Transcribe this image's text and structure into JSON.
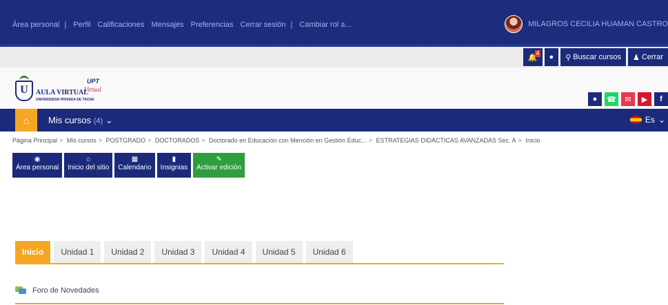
{
  "topnav": {
    "links": [
      "Área personal",
      "Perfil",
      "Calificaciones",
      "Mensajes",
      "Preferencias",
      "Cerrar sesión",
      "Cambiar rol a..."
    ],
    "user_name": "MILAGROS CECILIA HUAMAN CASTRO"
  },
  "toolbar": {
    "notifications_count": "4",
    "search_label": "Buscar cursos",
    "close_label": "Cerrar"
  },
  "logo": {
    "name": "AULA VIRTUAL",
    "sub": "UNIVERSIDAD PRIVADA DE TACNA",
    "upt": "UPT",
    "virtual": "Virtual"
  },
  "social": [
    "globe",
    "whatsapp",
    "mail",
    "youtube",
    "facebook"
  ],
  "mainnav": {
    "mycourses": "Mis cursos",
    "count": "(4)",
    "lang": "Es"
  },
  "breadcrumb": [
    "Página Principal",
    "Mis cursos",
    "POSTGRADO",
    "DOCTORADOS",
    "Doctorado en Educación con Mención en Gestión Educ...",
    "ESTRATEGIAS DIDÁCTICAS AVANZADAS Sec. A",
    "Inicio"
  ],
  "actions": [
    {
      "label": "Área personal",
      "icon": "dashboard-icon"
    },
    {
      "label": "Inicio del sitio",
      "icon": "home-icon"
    },
    {
      "label": "Calendario",
      "icon": "calendar-icon"
    },
    {
      "label": "Insignias",
      "icon": "bookmark-icon"
    },
    {
      "label": "Activar edición",
      "icon": "edit-icon"
    }
  ],
  "tabs": [
    "Inicio",
    "Unidad 1",
    "Unidad 2",
    "Unidad 3",
    "Unidad 4",
    "Unidad 5",
    "Unidad 6"
  ],
  "forum": "Foro de Novedades",
  "colors": {
    "primary": "#1b2a7a",
    "accent": "#f5a623",
    "green": "#2e9e3f"
  }
}
